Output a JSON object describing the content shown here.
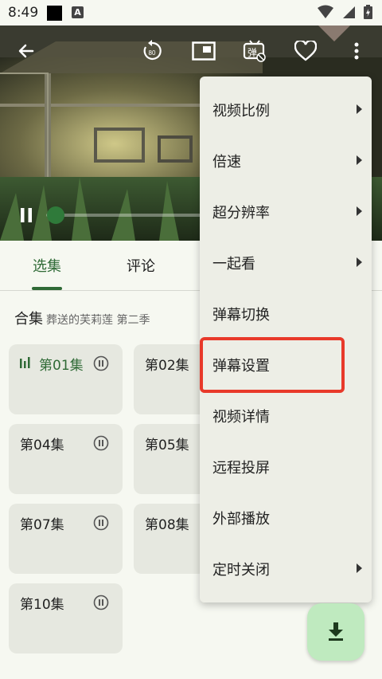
{
  "status_bar": {
    "time": "8:49",
    "a_icon": "A"
  },
  "player": {
    "rewind_badge": "80",
    "danmaku_badge": "弹"
  },
  "tabs": [
    {
      "label": "选集",
      "active": true
    },
    {
      "label": "评论",
      "active": false
    }
  ],
  "collection": {
    "title": "合集",
    "subtitle": "葬送的芙莉莲 第二季"
  },
  "episodes": [
    {
      "label": "第01集",
      "playing": true
    },
    {
      "label": "第02集",
      "playing": false
    },
    {
      "label": "第04集",
      "playing": false
    },
    {
      "label": "第05集",
      "playing": false
    },
    {
      "label": "第07集",
      "playing": false
    },
    {
      "label": "第08集",
      "playing": false
    },
    {
      "label": "第10集",
      "playing": false
    }
  ],
  "menu": {
    "items": [
      {
        "label": "视频比例",
        "has_submenu": true
      },
      {
        "label": "倍速",
        "has_submenu": true
      },
      {
        "label": "超分辨率",
        "has_submenu": true
      },
      {
        "label": "一起看",
        "has_submenu": true
      },
      {
        "label": "弹幕切换",
        "has_submenu": false
      },
      {
        "label": "弹幕设置",
        "has_submenu": false,
        "highlighted": true
      },
      {
        "label": "视频详情",
        "has_submenu": false
      },
      {
        "label": "远程投屏",
        "has_submenu": false
      },
      {
        "label": "外部播放",
        "has_submenu": false
      },
      {
        "label": "定时关闭",
        "has_submenu": true
      }
    ]
  },
  "colors": {
    "accent": "#2f6a36",
    "highlight_box": "#e8392a",
    "fab": "#bfeabf"
  }
}
